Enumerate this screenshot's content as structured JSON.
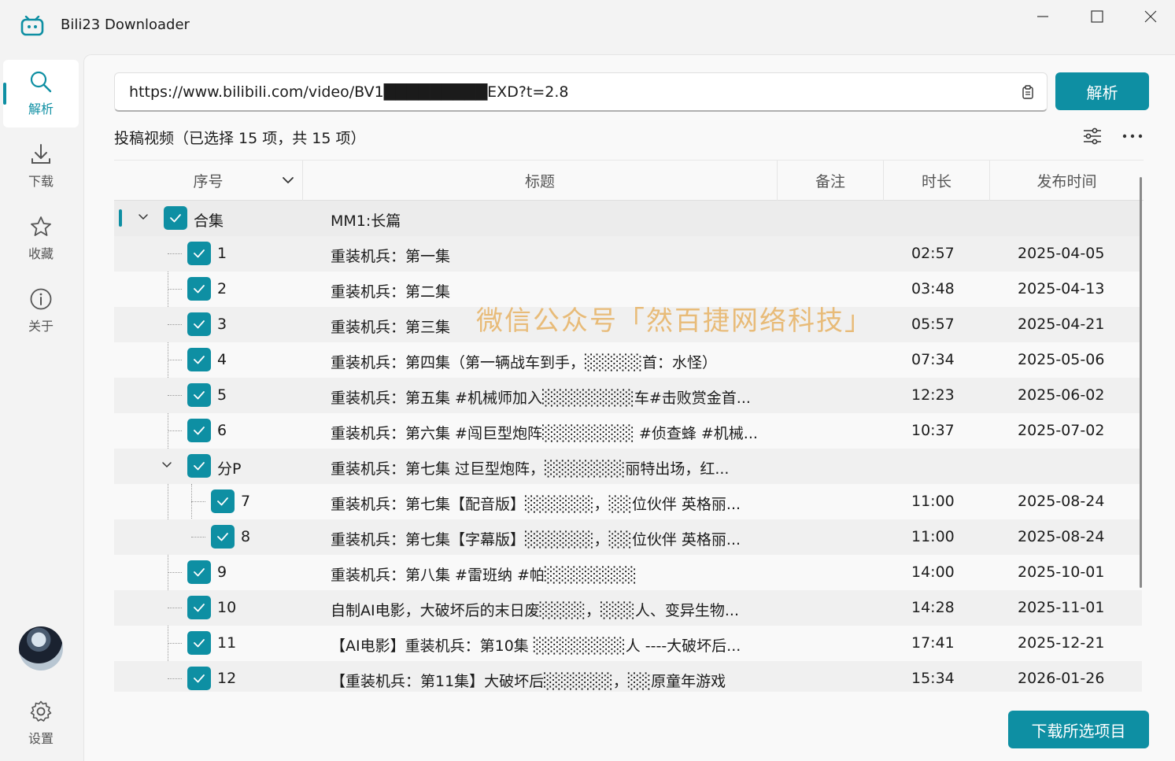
{
  "window": {
    "title": "Bili23 Downloader"
  },
  "sidebar": {
    "items": [
      {
        "label": "解析",
        "icon": "search-icon"
      },
      {
        "label": "下载",
        "icon": "download-icon"
      },
      {
        "label": "收藏",
        "icon": "star-icon"
      },
      {
        "label": "关于",
        "icon": "info-icon"
      }
    ],
    "settings_label": "设置"
  },
  "url_bar": {
    "value": "https://www.bilibili.com/video/BV1█████████EXD?t=2.8"
  },
  "parse_button": "解析",
  "section_title": "投稿视频（已选择 15 项，共 15 项）",
  "table": {
    "headers": [
      "序号",
      "标题",
      "备注",
      "时长",
      "发布时间"
    ],
    "rows": [
      {
        "seq": "合集",
        "title": "MM1:长篇",
        "duration": "",
        "date": ""
      },
      {
        "seq": "1",
        "title": "重装机兵：第一集",
        "duration": "02:57",
        "date": "2025-04-05"
      },
      {
        "seq": "2",
        "title": "重装机兵：第二集",
        "duration": "03:48",
        "date": "2025-04-13"
      },
      {
        "seq": "3",
        "title": "重装机兵：第三集",
        "duration": "05:57",
        "date": "2025-04-21"
      },
      {
        "seq": "4",
        "title": "重装机兵：第四集（第一辆战车到手，░░░░░首：水怪）",
        "duration": "07:34",
        "date": "2025-05-06"
      },
      {
        "seq": "5",
        "title": "重装机兵：第五集 #机械师加入░░░░░░░░车#击败赏金首...",
        "duration": "12:23",
        "date": "2025-06-02"
      },
      {
        "seq": "6",
        "title": "重装机兵：第六集 #闯巨型炮阵░░░░░░░░ #侦查蜂 #机械...",
        "duration": "10:37",
        "date": "2025-07-02"
      },
      {
        "seq": "分P",
        "title": "重装机兵：第七集 过巨型炮阵，░░░░░░░丽特出场，红...",
        "duration": "",
        "date": ""
      },
      {
        "seq": "7",
        "title": "重装机兵：第七集【配音版】░░░░░░，░░位伙伴 英格丽...",
        "duration": "11:00",
        "date": "2025-08-24"
      },
      {
        "seq": "8",
        "title": "重装机兵：第七集【字幕版】░░░░░░，░░位伙伴 英格丽...",
        "duration": "11:00",
        "date": "2025-08-24"
      },
      {
        "seq": "9",
        "title": "重装机兵：第八集 #雷班纳 #帕░░░░░░░░",
        "duration": "14:00",
        "date": "2025-10-01"
      },
      {
        "seq": "10",
        "title": "自制AI电影，大破坏后的末日废░░░░，░░░人、变异生物...",
        "duration": "14:28",
        "date": "2025-11-01"
      },
      {
        "seq": "11",
        "title": "【AI电影】重装机兵：第10集 ░░░░░░░░人 ----大破坏后...",
        "duration": "17:41",
        "date": "2025-12-21"
      },
      {
        "seq": "12",
        "title": "【重装机兵：第11集】大破坏后░░░░░░，░░原童年游戏",
        "duration": "15:34",
        "date": "2026-01-26"
      }
    ]
  },
  "watermark": "微信公众号「然百捷网络科技」",
  "download_button": "下载所选项目",
  "colors": {
    "accent": "#0e8fa3",
    "background": "#f3f3f3",
    "panel": "#f9f9f9"
  }
}
